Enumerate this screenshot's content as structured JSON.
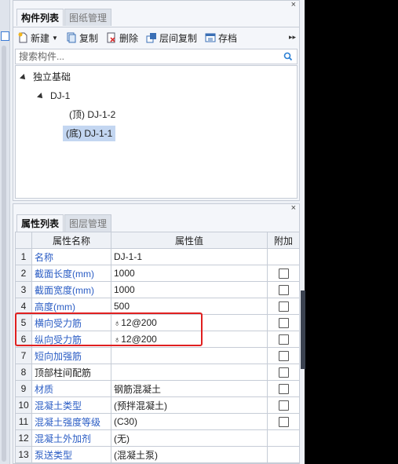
{
  "top_panel": {
    "tabs": [
      {
        "label": "构件列表",
        "active": true
      },
      {
        "label": "图纸管理",
        "active": false
      }
    ],
    "toolbar": {
      "new_label": "新建",
      "copy_label": "复制",
      "delete_label": "删除",
      "floor_copy_label": "层间复制",
      "save_label": "存档",
      "more_glyph": "▸▸"
    },
    "search": {
      "placeholder": "搜索构件..."
    },
    "tree": {
      "root": "独立基础",
      "child": "DJ-1",
      "leaves": [
        "(顶) DJ-1-2",
        "(底) DJ-1-1"
      ],
      "selected_leaf": 1
    }
  },
  "bottom_panel": {
    "tabs": [
      {
        "label": "属性列表",
        "active": true
      },
      {
        "label": "图层管理",
        "active": false
      }
    ],
    "headers": [
      "",
      "属性名称",
      "属性值",
      "附加"
    ],
    "rows": [
      {
        "num": "1",
        "name": "名称",
        "value": "DJ-1-1",
        "blue": true,
        "checkbox": false
      },
      {
        "num": "2",
        "name": "截面长度(mm)",
        "value": "1000",
        "blue": true,
        "checkbox": true
      },
      {
        "num": "3",
        "name": "截面宽度(mm)",
        "value": "1000",
        "blue": true,
        "checkbox": true
      },
      {
        "num": "4",
        "name": "高度(mm)",
        "value": "500",
        "blue": true,
        "checkbox": true
      },
      {
        "num": "5",
        "name": "横向受力筋",
        "value": "12@200",
        "rebar": "♁",
        "blue": true,
        "checkbox": true
      },
      {
        "num": "6",
        "name": "纵向受力筋",
        "value": "12@200",
        "rebar": "♁",
        "blue": true,
        "checkbox": true
      },
      {
        "num": "7",
        "name": "短向加强筋",
        "value": "",
        "blue": true,
        "checkbox": true
      },
      {
        "num": "8",
        "name": "顶部柱间配筋",
        "value": "",
        "blue": false,
        "checkbox": true
      },
      {
        "num": "9",
        "name": "材质",
        "value": "钢筋混凝土",
        "blue": true,
        "checkbox": true
      },
      {
        "num": "10",
        "name": "混凝土类型",
        "value": "(预拌混凝土)",
        "blue": true,
        "checkbox": true
      },
      {
        "num": "11",
        "name": "混凝土强度等级",
        "value": "(C30)",
        "blue": true,
        "checkbox": true
      },
      {
        "num": "12",
        "name": "混凝土外加剂",
        "value": "(无)",
        "blue": true,
        "checkbox": false
      },
      {
        "num": "13",
        "name": "泵送类型",
        "value": "(混凝土泵)",
        "blue": true,
        "checkbox": false
      }
    ]
  },
  "colors": {
    "accent_blue": "#2a5cc4",
    "highlight_red": "#e02020",
    "selection": "#c3d6f1"
  }
}
